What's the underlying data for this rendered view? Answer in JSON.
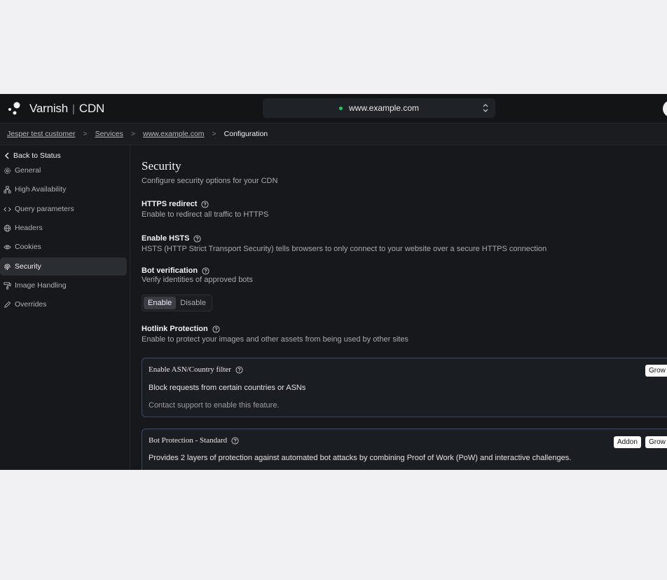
{
  "app": {
    "brand": "Varnish",
    "product": "CDN",
    "separator": "|"
  },
  "domain_selector": {
    "value": "www.example.com",
    "status_color": "#27c56a"
  },
  "breadcrumb": {
    "items": [
      "Jesper test customer",
      "Services",
      "www.example.com"
    ],
    "current": "Configuration",
    "separator": ">"
  },
  "sidebar": {
    "back_label": "Back to Status",
    "items": [
      {
        "label": "General",
        "icon": "gear-icon"
      },
      {
        "label": "High Availability",
        "icon": "network-icon"
      },
      {
        "label": "Query parameters",
        "icon": "code-icon"
      },
      {
        "label": "Headers",
        "icon": "globe-icon"
      },
      {
        "label": "Cookies",
        "icon": "eye-icon"
      },
      {
        "label": "Security",
        "icon": "fingerprint-icon",
        "active": true
      },
      {
        "label": "Image Handling",
        "icon": "paint-roller-icon"
      },
      {
        "label": "Overrides",
        "icon": "pencil-icon"
      }
    ]
  },
  "main": {
    "title": "Security",
    "subtitle": "Configure security options for your CDN",
    "https_redirect": {
      "label": "HTTPS redirect",
      "desc": "Enable to redirect all traffic to HTTPS"
    },
    "hsts": {
      "label": "Enable HSTS",
      "desc": "HSTS (HTTP Strict Transport Security) tells browsers to only connect to your website over a secure HTTPS connection"
    },
    "bot_verification": {
      "label": "Bot verification",
      "desc": "Verify identities of approved bots",
      "options": [
        "Enable",
        "Disable"
      ],
      "selected": "Enable"
    },
    "hotlink": {
      "label": "Hotlink Protection",
      "desc": "Enable to protect your images and other assets from being used by other sites"
    },
    "asn_card": {
      "title": "Enable ASN/Country filter",
      "desc": "Block requests from certain countries or ASNs",
      "note": "Contact support to enable this feature.",
      "badge": "Grow"
    },
    "bot_card": {
      "title": "Bot Protection - Standard",
      "desc": "Provides 2 layers of protection against automated bot attacks by combining Proof of Work (PoW) and interactive challenges.",
      "badges": [
        "Addon",
        "Grow"
      ]
    }
  }
}
